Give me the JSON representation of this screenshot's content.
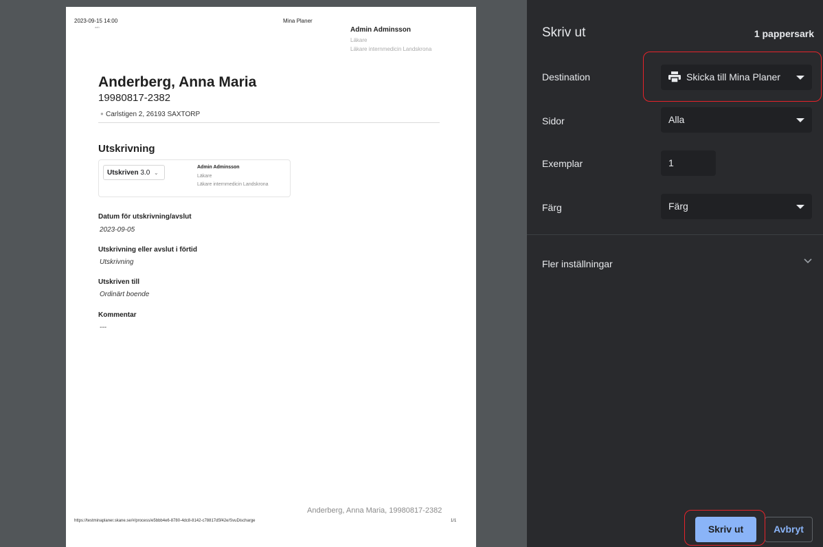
{
  "preview": {
    "header": {
      "datetime": "2023-09-15 14:00",
      "tiny_text": "aah",
      "app_name": "Mina Planer",
      "user_name": "Admin Adminsson",
      "user_role": "Läkare",
      "user_unit": "Läkare internmedicin Landskrona"
    },
    "patient": {
      "name": "Anderberg, Anna Maria",
      "pnr": "19980817-2382",
      "address": "Carlstigen 2, 26193 SAXTORP"
    },
    "section_title": "Utskrivning",
    "status_card": {
      "status_label": "Utskriven",
      "version": "3.0",
      "user_name": "Admin Adminsson",
      "user_role": "Läkare",
      "user_unit": "Läkare internmedicin Landskrona"
    },
    "fields": [
      {
        "label": "Datum för utskrivning/avslut",
        "value": "2023-09-05"
      },
      {
        "label": "Utskrivning eller avslut i förtid",
        "value": "Utskrivning"
      },
      {
        "label": "Utskriven till",
        "value": "Ordinärt boende"
      },
      {
        "label": "Kommentar",
        "value": "---"
      }
    ],
    "footer": {
      "patient_summary": "Anderberg, Anna Maria, 19980817-2382",
      "url": "https://testminaplaner.skane.se/#/process/e5bbb4e6-8780-4dc8-8142-c78817d5f42e/SvuDischarge",
      "page_count": "1/1"
    }
  },
  "settings": {
    "title": "Skriv ut",
    "sheet_count": "1 pappersark",
    "destination": {
      "label": "Destination",
      "value": "Skicka till Mina Planer",
      "icon": "printer-icon"
    },
    "pages": {
      "label": "Sidor",
      "value": "Alla"
    },
    "copies": {
      "label": "Exemplar",
      "value": "1"
    },
    "color": {
      "label": "Färg",
      "value": "Färg"
    },
    "more_settings": {
      "label": "Fler inställningar",
      "icon": "chevron-down-icon"
    },
    "print_button": "Skriv ut",
    "cancel_button": "Avbryt",
    "colors": {
      "panel_bg": "#292a2d",
      "field_bg": "#202124",
      "accent": "#8ab4f8",
      "highlight": "#e8232a",
      "preview_bg": "#525659"
    }
  }
}
